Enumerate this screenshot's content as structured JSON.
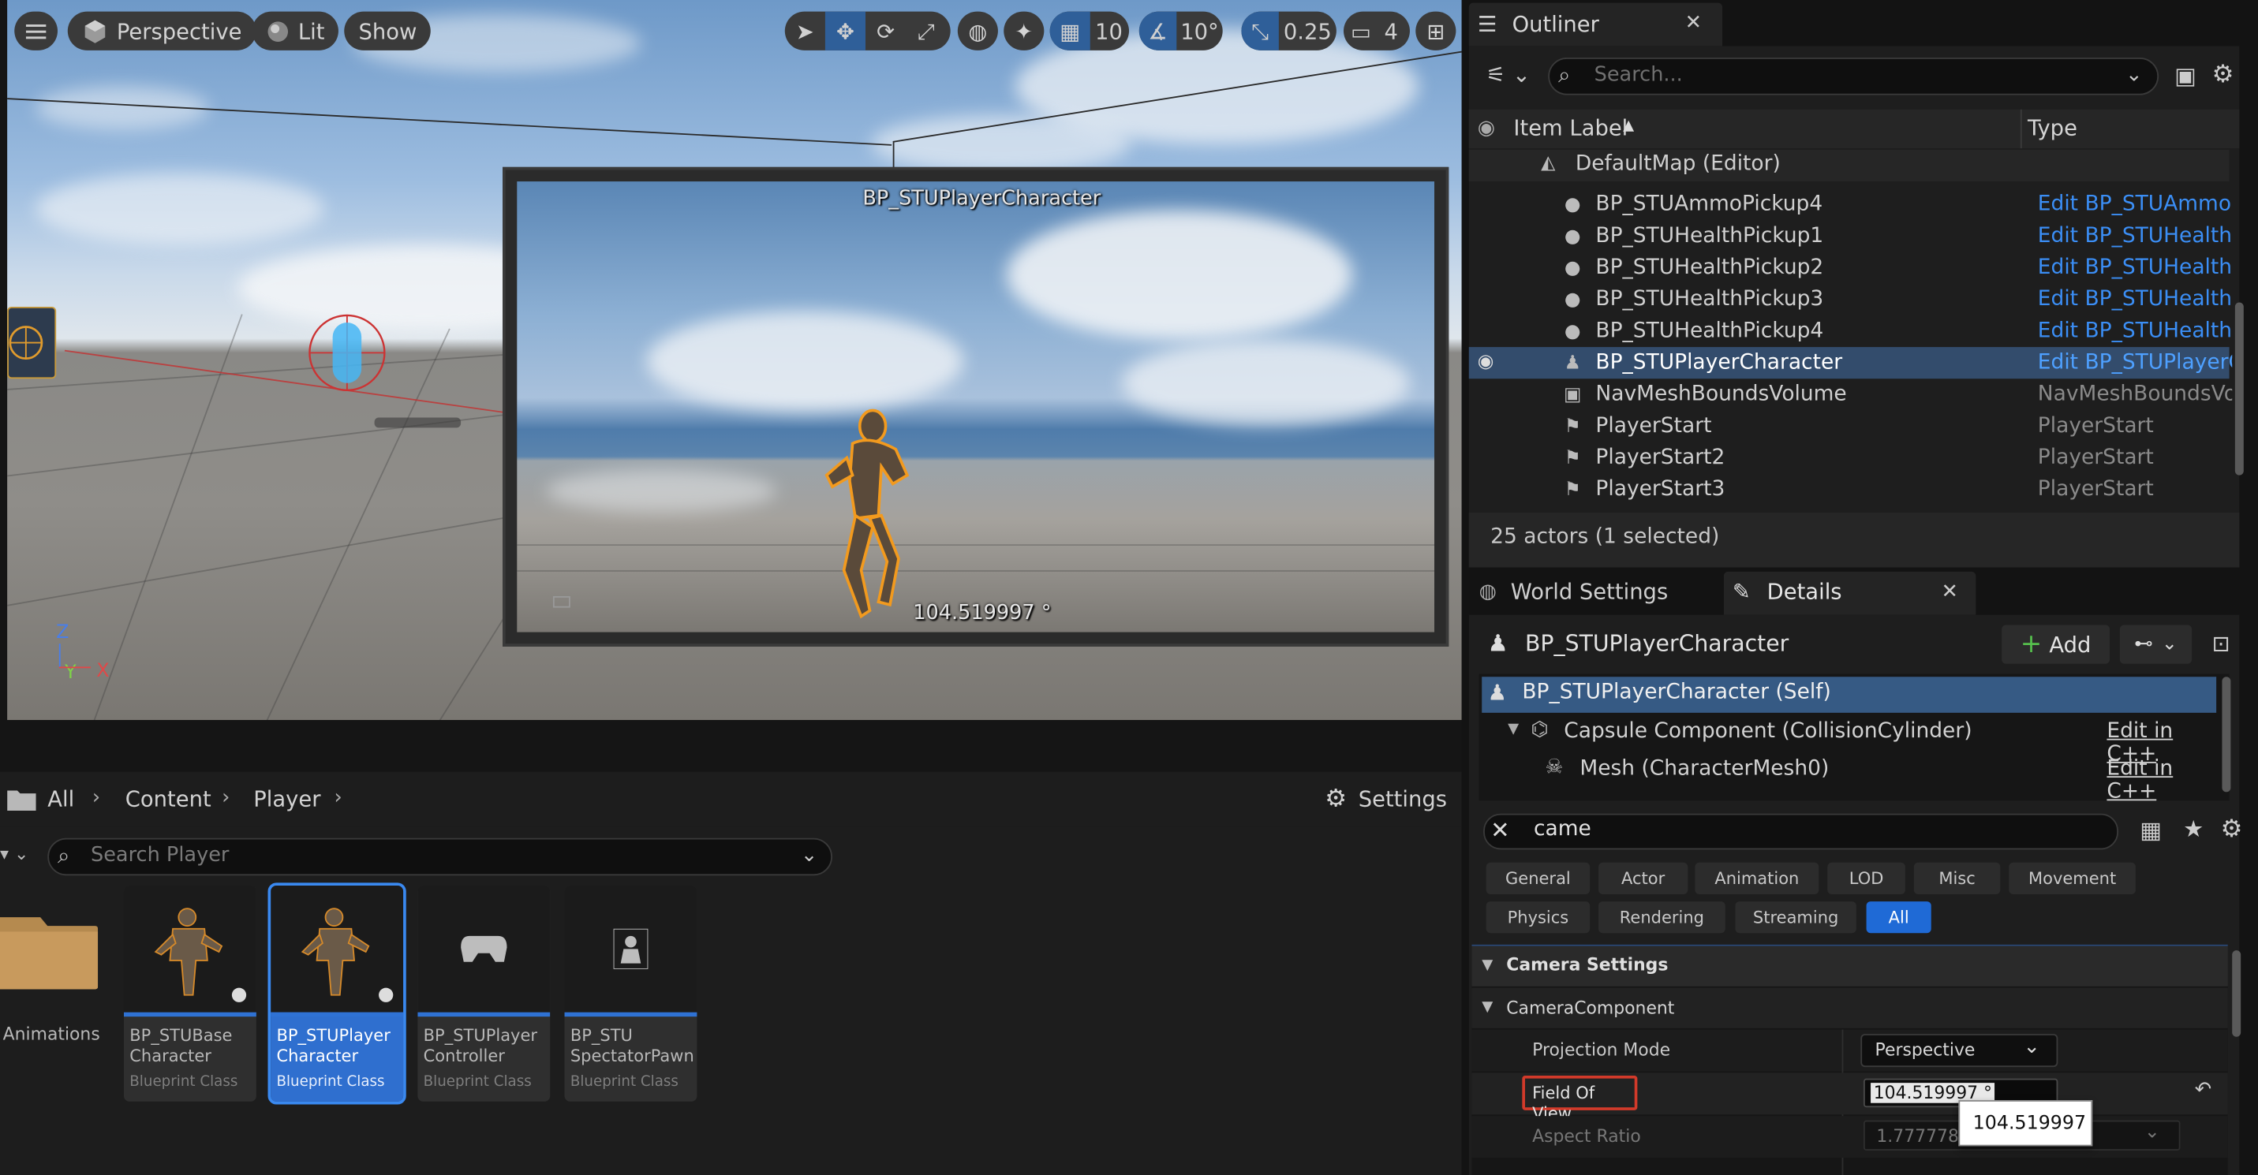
{
  "viewport": {
    "perspective_label": "Perspective",
    "lit_label": "Lit",
    "show_label": "Show",
    "grid_snap": "10",
    "angle_snap": "10°",
    "scale_snap": "0.25",
    "camera_speed": "4",
    "axis_x": "X",
    "axis_y": "Y",
    "axis_z": "Z"
  },
  "camera_preview": {
    "title": "BP_STUPlayerCharacter",
    "fov_readout": "104.519997 °"
  },
  "outliner": {
    "tab_title": "Outliner",
    "search_placeholder": "Search...",
    "col_label": "Item Label",
    "col_type": "Type",
    "map_row": "DefaultMap (Editor)",
    "rows": [
      {
        "name": "BP_STUAmmoPickup4",
        "type": "Edit BP_STUAmmoF",
        "kind": "link",
        "icon": "sphere-icon"
      },
      {
        "name": "BP_STUHealthPickup1",
        "type": "Edit BP_STUHealthF",
        "kind": "link",
        "icon": "sphere-icon"
      },
      {
        "name": "BP_STUHealthPickup2",
        "type": "Edit BP_STUHealthF",
        "kind": "link",
        "icon": "sphere-icon"
      },
      {
        "name": "BP_STUHealthPickup3",
        "type": "Edit BP_STUHealthF",
        "kind": "link",
        "icon": "sphere-icon"
      },
      {
        "name": "BP_STUHealthPickup4",
        "type": "Edit BP_STUHealthF",
        "kind": "link",
        "icon": "sphere-icon"
      },
      {
        "name": "BP_STUPlayerCharacter",
        "type": "Edit BP_STUPlayerC",
        "kind": "link",
        "icon": "pawn-icon",
        "selected": true
      },
      {
        "name": "NavMeshBoundsVolume",
        "type": "NavMeshBoundsVol",
        "kind": "gray",
        "icon": "volume-icon"
      },
      {
        "name": "PlayerStart",
        "type": "PlayerStart",
        "kind": "gray",
        "icon": "flag-icon"
      },
      {
        "name": "PlayerStart2",
        "type": "PlayerStart",
        "kind": "gray",
        "icon": "flag-icon"
      },
      {
        "name": "PlayerStart3",
        "type": "PlayerStart",
        "kind": "gray",
        "icon": "flag-icon"
      }
    ],
    "status": "25 actors (1 selected)"
  },
  "details": {
    "world_settings_tab": "World Settings",
    "details_tab": "Details",
    "actor_name": "BP_STUPlayerCharacter",
    "add_label": "Add",
    "components": [
      {
        "name": "BP_STUPlayerCharacter (Self)",
        "edit": ""
      },
      {
        "name": "Capsule Component (CollisionCylinder)",
        "edit": "Edit in C++"
      },
      {
        "name": "Mesh (CharacterMesh0)",
        "edit": "Edit in C++"
      }
    ],
    "filter_value": "came",
    "filters_row1": [
      "General",
      "Actor",
      "Animation",
      "LOD",
      "Misc",
      "Movement"
    ],
    "filters_row2": [
      "Physics",
      "Rendering",
      "Streaming",
      "All"
    ],
    "section_camera_settings": "Camera Settings",
    "section_camera_component": "CameraComponent",
    "projection_mode_label": "Projection Mode",
    "projection_mode_value": "Perspective",
    "fov_label": "Field Of View",
    "fov_value": "104.519997 °",
    "fov_tooltip": "104.519997",
    "aspect_label": "Aspect Ratio",
    "aspect_value": "1.777778"
  },
  "content_browser": {
    "crumbs": [
      "All",
      "Content",
      "Player"
    ],
    "settings_label": "Settings",
    "search_placeholder": "Search Player",
    "folder_label": "Animations",
    "assets": [
      {
        "line1": "BP_STUBase",
        "line2": "Character",
        "type": "Blueprint Class"
      },
      {
        "line1": "BP_STUPlayer",
        "line2": "Character",
        "type": "Blueprint Class",
        "selected": true
      },
      {
        "line1": "BP_STUPlayer",
        "line2": "Controller",
        "type": "Blueprint Class"
      },
      {
        "line1": "BP_STU",
        "line2": "SpectatorPawn",
        "type": "Blueprint Class"
      }
    ]
  },
  "colors": {
    "accent": "#1f6ad6",
    "link": "#3b8ef5",
    "highlight_border": "#d23a2a"
  }
}
